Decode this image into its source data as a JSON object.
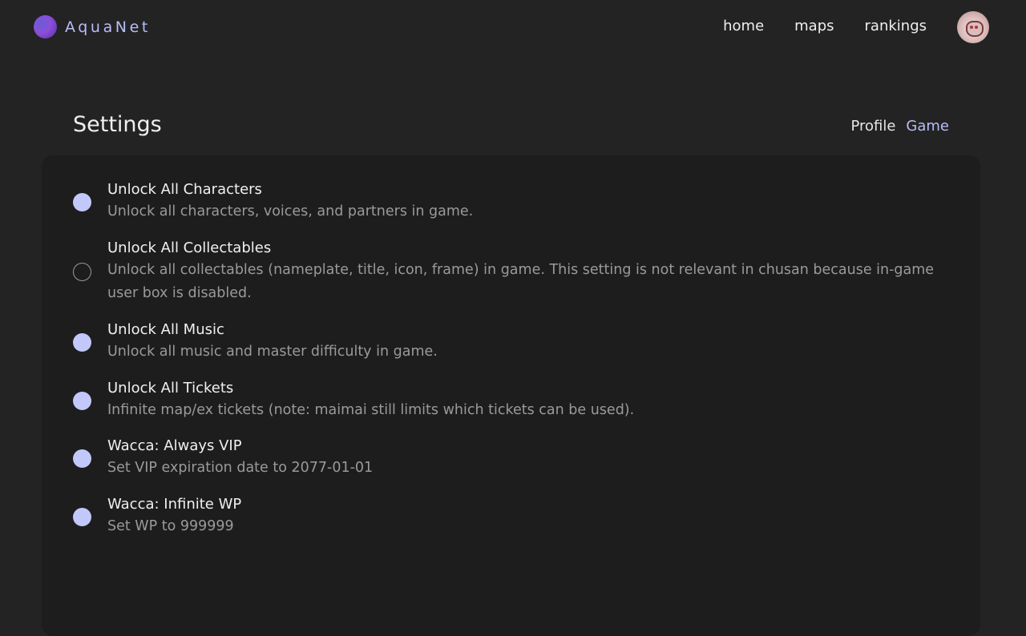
{
  "brand": {
    "name": "AquaNet"
  },
  "nav": {
    "home": "home",
    "maps": "maps",
    "rankings": "rankings"
  },
  "page": {
    "title": "Settings",
    "tabs": {
      "profile": "Profile",
      "game": "Game"
    },
    "active_tab": "Game"
  },
  "settings": [
    {
      "title": "Unlock All Characters",
      "desc": "Unlock all characters, voices, and partners in game.",
      "enabled": true
    },
    {
      "title": "Unlock All Collectables",
      "desc": "Unlock all collectables (nameplate, title, icon, frame) in game. This setting is not relevant in chusan because in-game user box is disabled.",
      "enabled": false
    },
    {
      "title": "Unlock All Music",
      "desc": "Unlock all music and master difficulty in game.",
      "enabled": true
    },
    {
      "title": "Unlock All Tickets",
      "desc": "Infinite map/ex tickets (note: maimai still limits which tickets can be used).",
      "enabled": true
    },
    {
      "title": "Wacca: Always VIP",
      "desc": "Set VIP expiration date to 2077-01-01",
      "enabled": true
    },
    {
      "title": "Wacca: Infinite WP",
      "desc": "Set WP to 999999",
      "enabled": true
    }
  ],
  "colors": {
    "accent": "#b7bdf8",
    "toggle_on": "#c3c8fb",
    "background": "#232323",
    "panel": "#1d1d1d"
  }
}
